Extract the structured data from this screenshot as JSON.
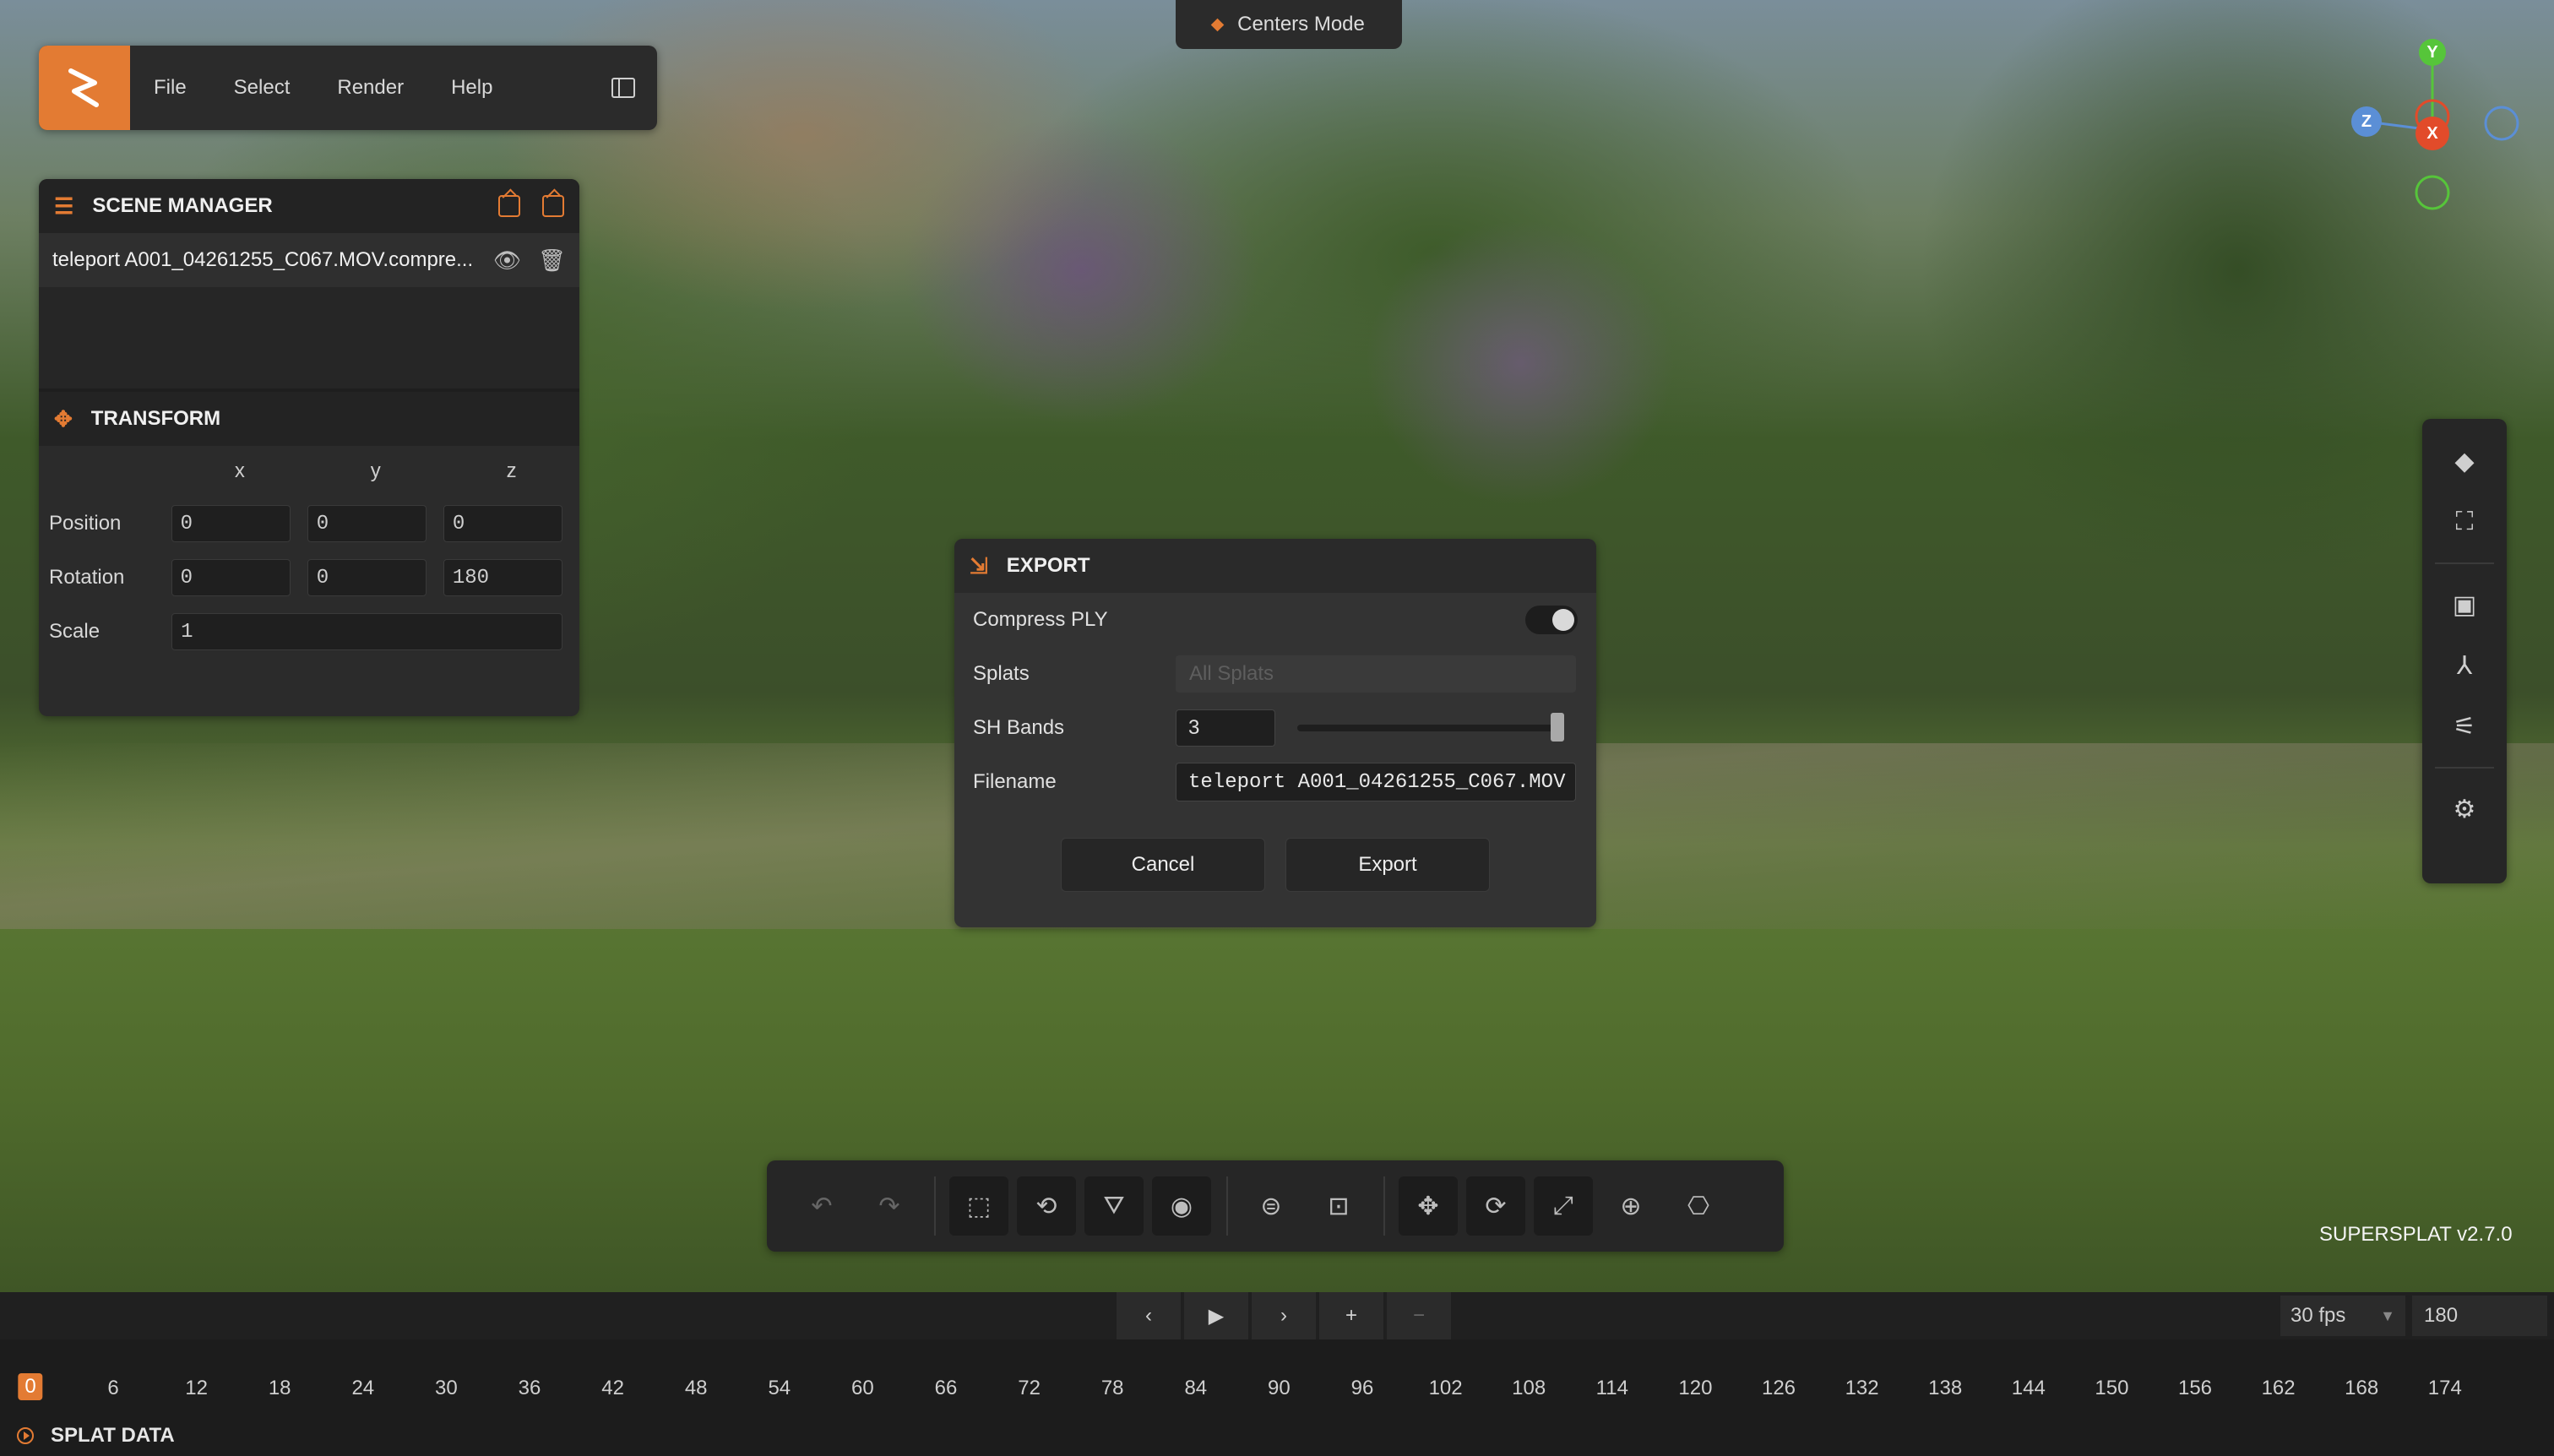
{
  "menubar": {
    "items": [
      "File",
      "Select",
      "Render",
      "Help"
    ]
  },
  "centers_mode": "Centers Mode",
  "scene_manager": {
    "title": "SCENE MANAGER",
    "splat_name": "teleport A001_04261255_C067.MOV.compre..."
  },
  "transform": {
    "title": "TRANSFORM",
    "axes": [
      "x",
      "y",
      "z"
    ],
    "position_label": "Position",
    "position": [
      "0",
      "0",
      "0"
    ],
    "rotation_label": "Rotation",
    "rotation": [
      "0",
      "0",
      "180"
    ],
    "scale_label": "Scale",
    "scale": "1"
  },
  "export": {
    "title": "EXPORT",
    "compress_label": "Compress PLY",
    "compress_on": true,
    "splats_label": "Splats",
    "splats_value": "All Splats",
    "sh_label": "SH Bands",
    "sh_value": "3",
    "filename_label": "Filename",
    "filename_value": "teleport A001_04261255_C067.MOV",
    "cancel_label": "Cancel",
    "export_label": "Export"
  },
  "gizmo": {
    "y": "Y",
    "z": "Z",
    "x": "X"
  },
  "version": "SUPERSPLAT v2.7.0",
  "timeline": {
    "fps": "30 fps",
    "frames": "180",
    "current_frame": "0",
    "ticks": [
      "6",
      "12",
      "18",
      "24",
      "30",
      "36",
      "42",
      "48",
      "54",
      "60",
      "66",
      "72",
      "78",
      "84",
      "90",
      "96",
      "102",
      "108",
      "114",
      "120",
      "126",
      "132",
      "138",
      "144",
      "150",
      "156",
      "162",
      "168",
      "174"
    ]
  },
  "splat_data_label": "SPLAT DATA",
  "colors": {
    "accent": "#e37b33",
    "panel": "#2b2b2b",
    "gizmo_x": "#e24b2a",
    "gizmo_y": "#56c53a",
    "gizmo_z": "#5b8fd6"
  }
}
